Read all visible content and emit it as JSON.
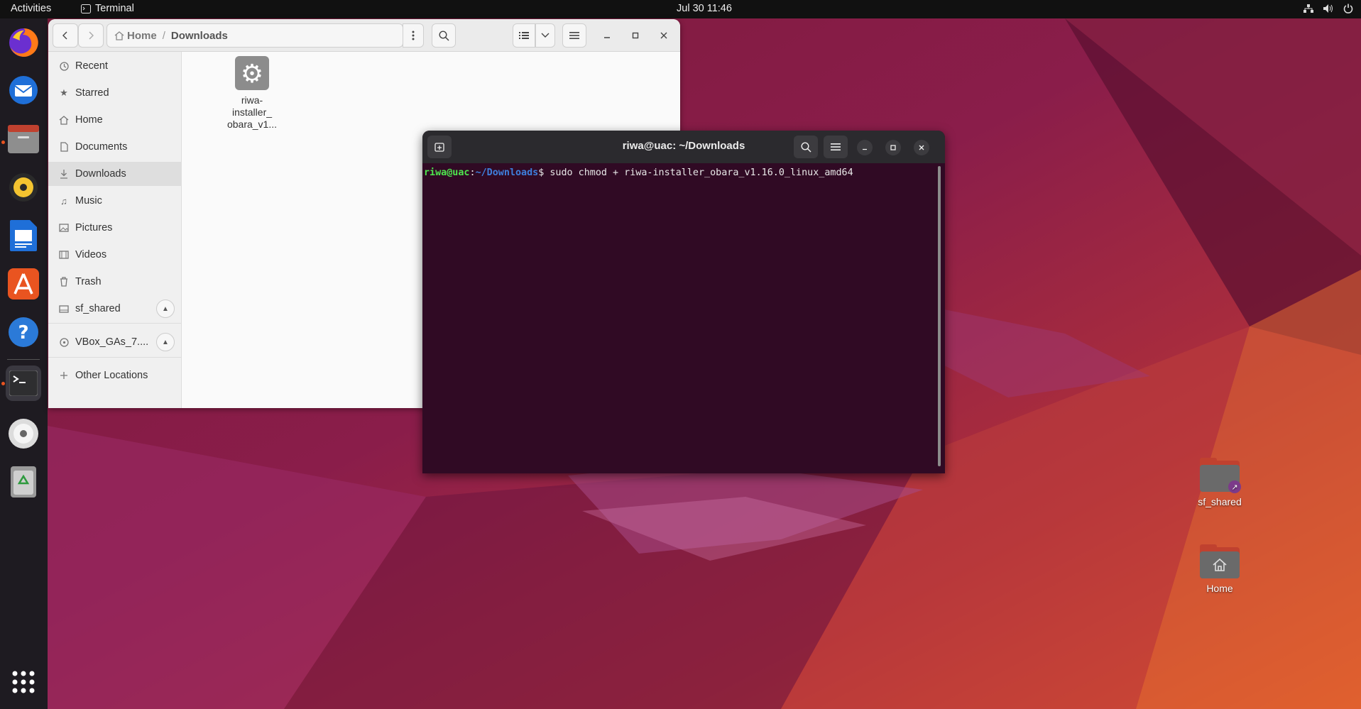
{
  "topbar": {
    "activities": "Activities",
    "app_name": "Terminal",
    "clock": "Jul 30  11:46",
    "status_icons": [
      "network-icon",
      "volume-icon",
      "power-icon"
    ]
  },
  "dock": {
    "items": [
      "firefox-icon",
      "thunderbird-icon",
      "files-icon",
      "rhythmbox-icon",
      "writer-icon",
      "app-center-icon",
      "help-icon",
      "terminal-icon",
      "dvd-icon",
      "trash-icon"
    ],
    "show_apps": "show-apps-icon"
  },
  "files": {
    "path": {
      "home": "Home",
      "current": "Downloads"
    },
    "sidebar": [
      {
        "label": "Recent",
        "icon": "clock-icon"
      },
      {
        "label": "Starred",
        "icon": "star-icon"
      },
      {
        "label": "Home",
        "icon": "home-icon"
      },
      {
        "label": "Documents",
        "icon": "document-icon"
      },
      {
        "label": "Downloads",
        "icon": "download-icon"
      },
      {
        "label": "Music",
        "icon": "music-icon"
      },
      {
        "label": "Pictures",
        "icon": "picture-icon"
      },
      {
        "label": "Videos",
        "icon": "video-icon"
      },
      {
        "label": "Trash",
        "icon": "trash-icon"
      },
      {
        "label": "sf_shared",
        "icon": "drive-icon"
      },
      {
        "label": "VBox_GAs_7....",
        "icon": "disc-icon"
      },
      {
        "label": "Other Locations",
        "icon": "plus-icon"
      }
    ],
    "file": {
      "line1": "riwa-",
      "line2": "installer_",
      "line3": "obara_v1..."
    }
  },
  "terminal": {
    "title": "riwa@uac: ~/Downloads",
    "prompt_user": "riwa@uac",
    "prompt_colon": ":",
    "prompt_path": "~/Downloads",
    "prompt_symbol": "$ ",
    "command": "sudo chmod + riwa-installer_obara_v1.16.0_linux_amd64"
  },
  "desktop": {
    "icons": [
      {
        "label": "sf_shared"
      },
      {
        "label": "Home"
      }
    ]
  }
}
